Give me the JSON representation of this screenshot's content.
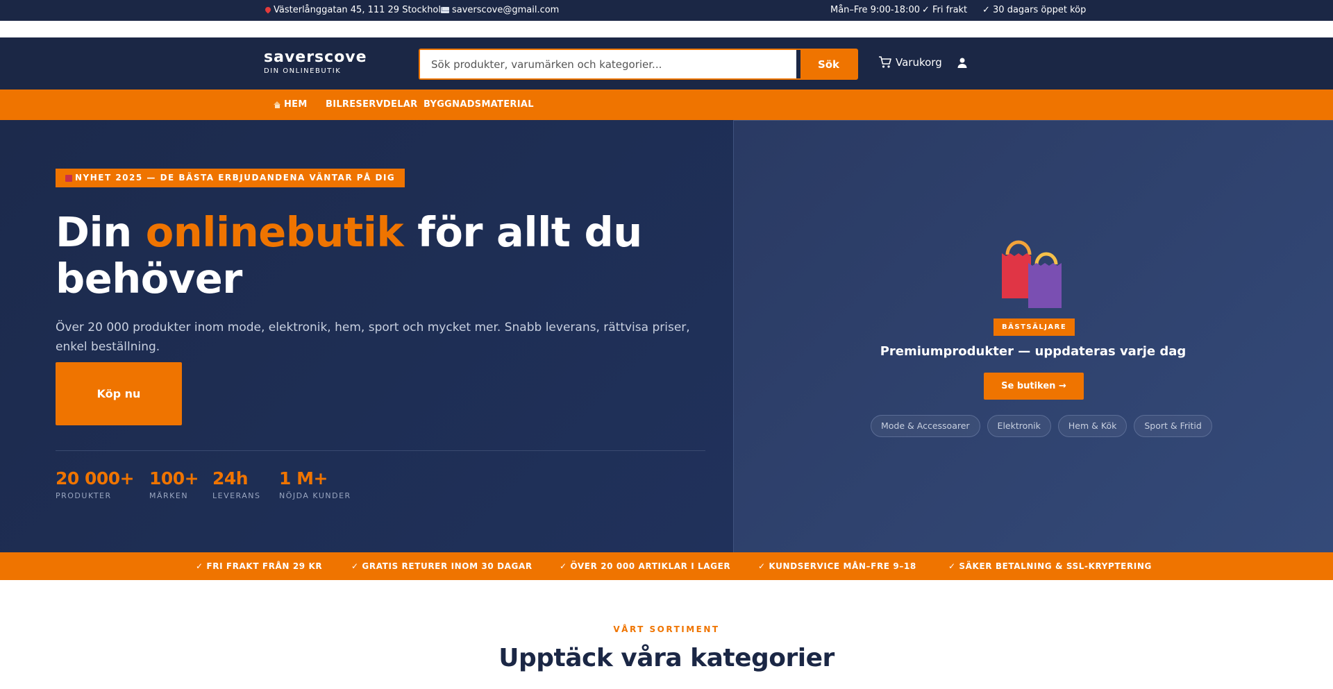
{
  "topbar": {
    "address": "Västerlånggatan 45, 111 29 Stockholm",
    "email": "saverscove@gmail.com",
    "hours": "Mån–Fre 9:00-18:00",
    "free_shipping": "✓ Fri frakt",
    "open_purchase": "✓ 30 dagars öppet köp"
  },
  "header": {
    "logo_name": "saverscove",
    "logo_tagline": "DIN ONLINEBUTIK",
    "search_placeholder": "Sök produkter, varumärken och kategorier...",
    "search_button": "Sök",
    "cart_label": "Varukorg"
  },
  "nav": {
    "items": [
      "HEM",
      "BILRESERVDELAR",
      "BYGGNADSMATERIAL"
    ]
  },
  "hero": {
    "badge": "NYHET 2025 — DE BÄSTA ERBJUDANDENA VÄNTAR PÅ DIG",
    "headline_pre": "Din ",
    "headline_accent": "onlinebutik",
    "headline_post": " för allt du behöver",
    "subtext": "Över 20 000 produkter inom mode, elektronik, hem, sport och mycket mer. Snabb leverans, rättvisa priser, enkel beställning.",
    "cta": "Köp nu",
    "stats": [
      {
        "value": "20 000+",
        "label": "PRODUKTER"
      },
      {
        "value": "100+",
        "label": "MÄRKEN"
      },
      {
        "value": "24h",
        "label": "LEVERANS"
      },
      {
        "value": "1 M+",
        "label": "NÖJDA KUNDER"
      }
    ]
  },
  "promo": {
    "badge": "BÄSTSÄLJARE",
    "title": "Premiumprodukter — uppdateras varje dag",
    "button": "Se butiken →",
    "chips": [
      "Mode & Accessoarer",
      "Elektronik",
      "Hem & Kök",
      "Sport & Fritid"
    ]
  },
  "features": [
    "✓ FRI FRAKT FRÅN 29 KR",
    "✓ GRATIS RETURER INOM 30 DAGAR",
    "✓ ÖVER 20 000 ARTIKLAR I LAGER",
    "✓ KUNDSERVICE MÅN–FRE 9–18",
    "✓ SÄKER BETALNING & SSL-KRYPTERING"
  ],
  "categories": {
    "kicker": "VÅRT SORTIMENT",
    "title": "Upptäck våra kategorier"
  },
  "colors": {
    "navy": "#1b2745",
    "orange": "#ef7400"
  },
  "icons": [
    "pin-icon",
    "envelope-icon",
    "cart-icon",
    "user-icon",
    "house-icon",
    "shopping-bags-icon"
  ]
}
